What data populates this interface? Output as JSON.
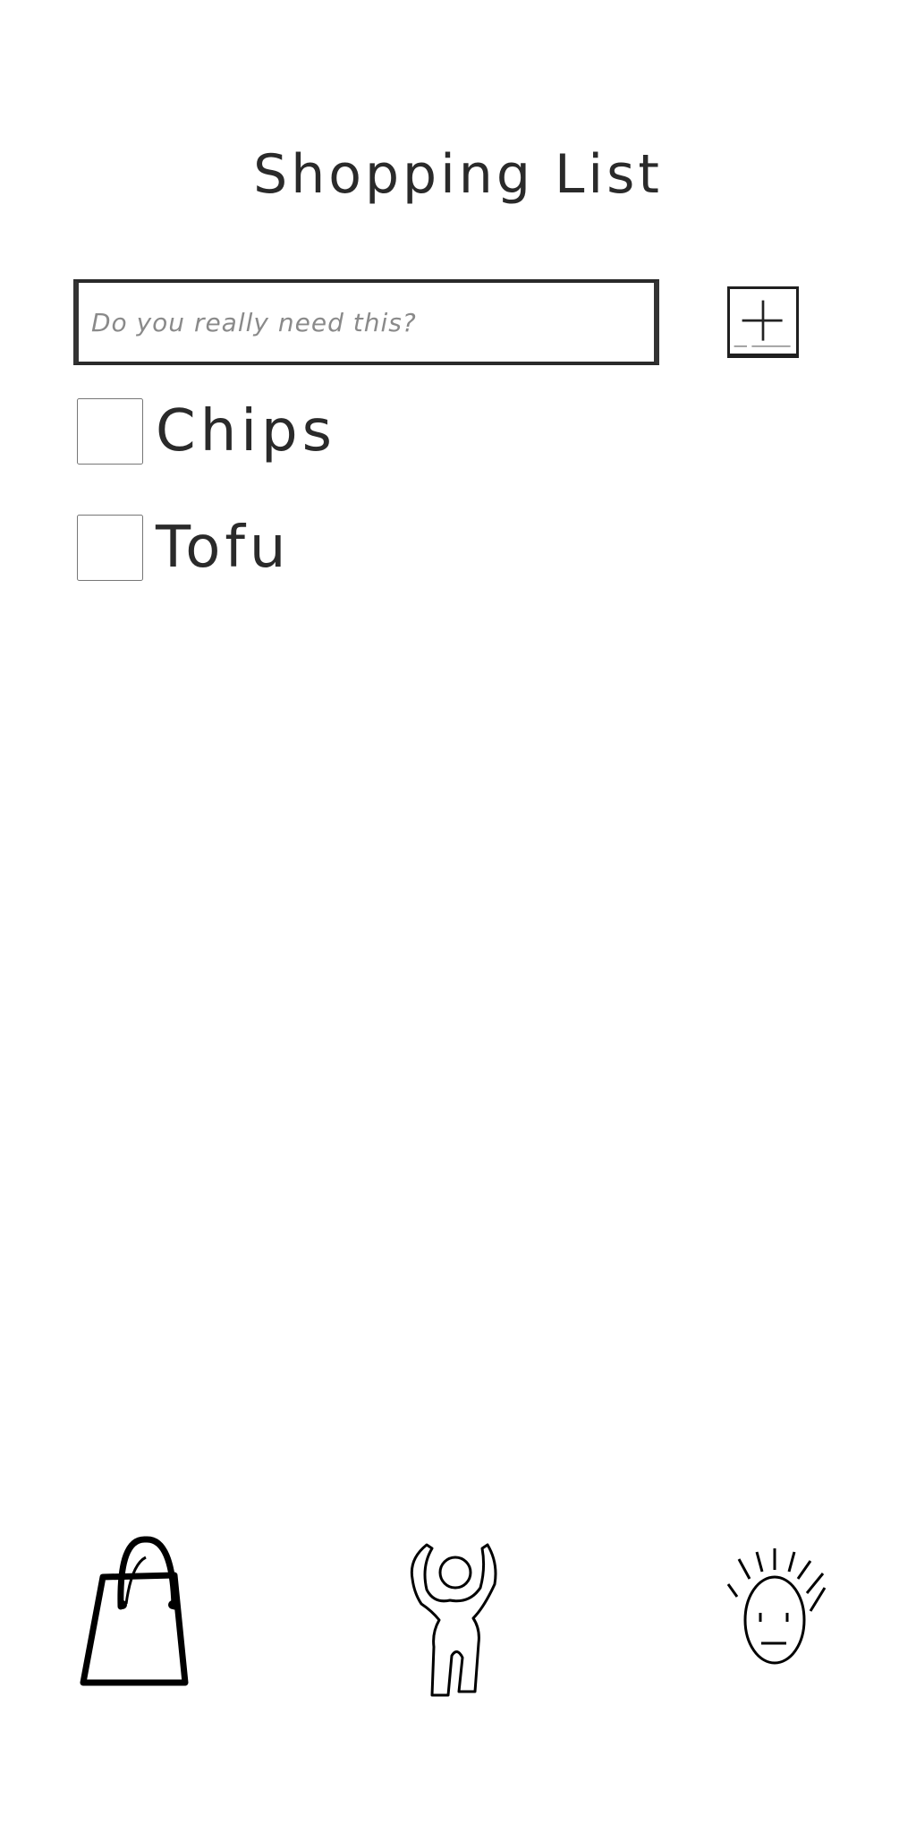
{
  "header": {
    "title": "Shopping List"
  },
  "new_item": {
    "placeholder": "Do you really need this?",
    "value": "",
    "add_button_icon": "plus-icon"
  },
  "items": [
    {
      "label": "Chips",
      "checked": false
    },
    {
      "label": "Tofu",
      "checked": false
    }
  ],
  "nav": [
    {
      "icon": "shopping-bag-icon"
    },
    {
      "icon": "dancing-person-icon"
    },
    {
      "icon": "surprised-face-icon"
    }
  ],
  "colors": {
    "ink": "#222222",
    "background": "#ffffff",
    "checkbox_fill": "#f4f4f4",
    "placeholder": "#8a8a8a"
  }
}
